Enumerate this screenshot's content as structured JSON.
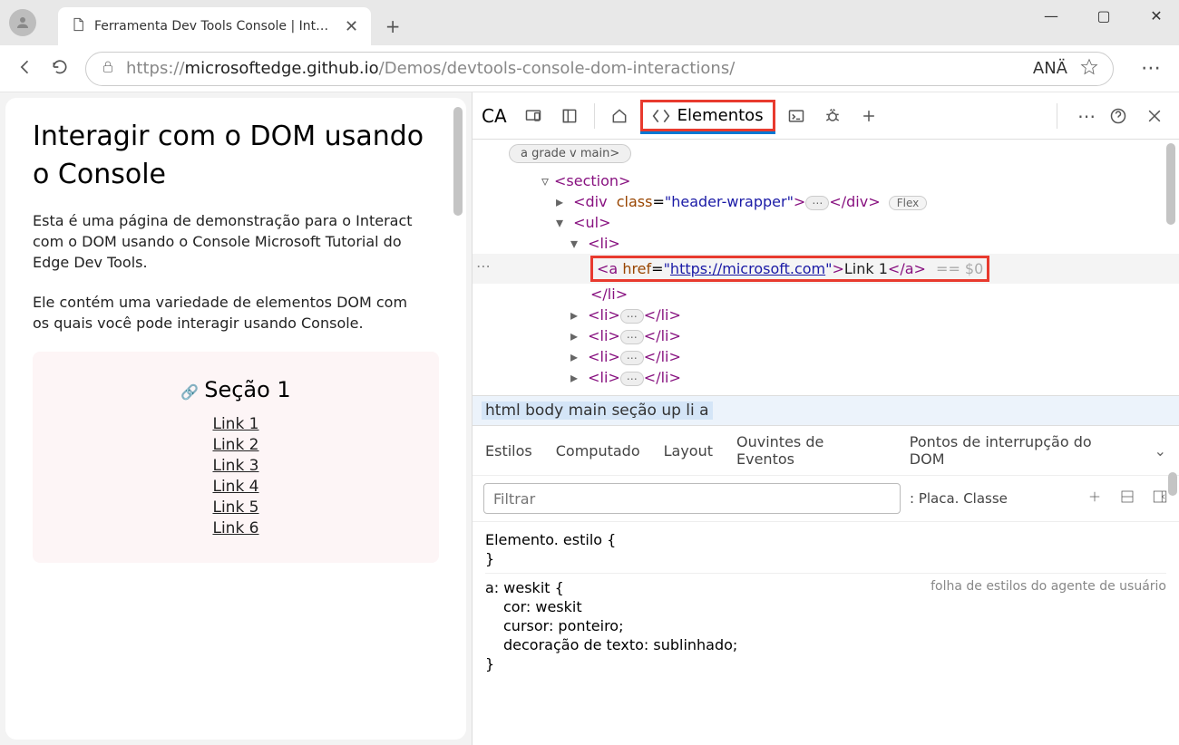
{
  "browser": {
    "tab_title": "Ferramenta Dev Tools Console | Intel DOM",
    "url_prefix": "https://",
    "url_host": "microsoftedge.github.io",
    "url_path": "/Demos/devtools-console-dom-interactions/",
    "profile_label": "ANÄ",
    "win_min": "—",
    "win_max": "▢",
    "win_close": "✕"
  },
  "page": {
    "h1": "Interagir com o DOM usando o Console",
    "p1": "Esta é uma página de demonstração para o Interact com o DOM usando o Console Microsoft Tutorial do Edge Dev Tools.",
    "p2": "Ele contém uma variedade de elementos DOM com os quais você pode interagir usando Console.",
    "section_title": "Seção 1",
    "links": [
      "Link 1",
      "Link 2",
      "Link 3",
      "Link 4",
      "Link 5",
      "Link 6"
    ]
  },
  "devtools": {
    "ca": "CA",
    "elements_tab": "Elementos",
    "crumb_pill": "a grade v main>",
    "breadcrumb": "html body main seção up li a",
    "dom": {
      "section_open": "<section>",
      "div_class": "header-wrapper",
      "flex_badge": "Flex",
      "ul": "ul",
      "li": "li",
      "a_href": "https://microsoft.com",
      "a_text": "Link 1",
      "eq": "== $0"
    },
    "styles_tabs": {
      "t1": "Estilos",
      "t2": "Computado",
      "t3": "Layout",
      "t4": "Ouvintes de Eventos",
      "t5": "Pontos de interrupção do DOM"
    },
    "filter_placeholder": "Filtrar",
    "filter_label": ": Placa. Classe",
    "rules": {
      "r1_sel": "Elemento. estilo {",
      "r1_close": "}",
      "r2_sel": "a: weskit {",
      "r2_origin": "folha de estilos do agente de usuário",
      "r2_p1": "cor: weskit",
      "r2_p2": "cursor: ponteiro;",
      "r2_p3": "decoração de texto: sublinhado;",
      "r2_close": "}"
    }
  }
}
